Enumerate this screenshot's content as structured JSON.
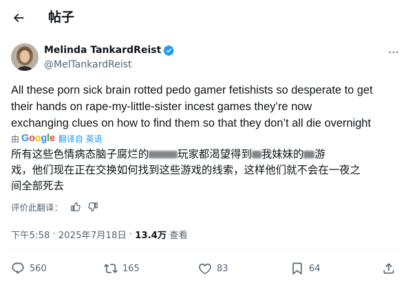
{
  "header": {
    "title": "帖子",
    "back_icon": "arrow-left-icon"
  },
  "author": {
    "display_name": "Melinda TankardReist",
    "handle": "@MelTankardReist",
    "verified_icon": "verified-badge-icon",
    "verified_color": "#1d9bf0",
    "more_icon": "more-horizontal-icon"
  },
  "tweet": {
    "lines": [
      "All these porn sick brain rotted pedo gamer fetishists so desperate to get",
      "their hands on rape-my-little-sister incest games they’re now",
      "exchanging clues on how to find them so that they don’t all die overnight"
    ]
  },
  "translation": {
    "by_text": "由",
    "provider": "Google",
    "link_text": "翻译自 英语",
    "line1_a": "所有这些色情病态脑子腐烂的",
    "line1_b": "玩家都渴望得到",
    "line1_c": "我妹妹的",
    "line1_d": "游",
    "line2": "戏，他们现在正在交换如何找到这些游戏的线索，这样他们就不会在一夜之",
    "line3": "间全部死去",
    "rate_label": "评价此翻译：",
    "thumb_up_icon": "thumb-up-icon",
    "thumb_down_icon": "thumb-down-icon"
  },
  "meta": {
    "time": "下午5:58",
    "date": "2025年7月18日",
    "views_count": "13.4万",
    "views_label": "查看"
  },
  "actions": {
    "reply_count": "560",
    "repost_count": "165",
    "like_count": "83",
    "bookmark_count": "64",
    "reply_icon": "reply-icon",
    "repost_icon": "repost-icon",
    "like_icon": "heart-icon",
    "bookmark_icon": "bookmark-icon",
    "share_icon": "share-icon"
  },
  "colors": {
    "text": "#0f1419",
    "secondary": "#536471",
    "accent": "#1d9bf0"
  }
}
